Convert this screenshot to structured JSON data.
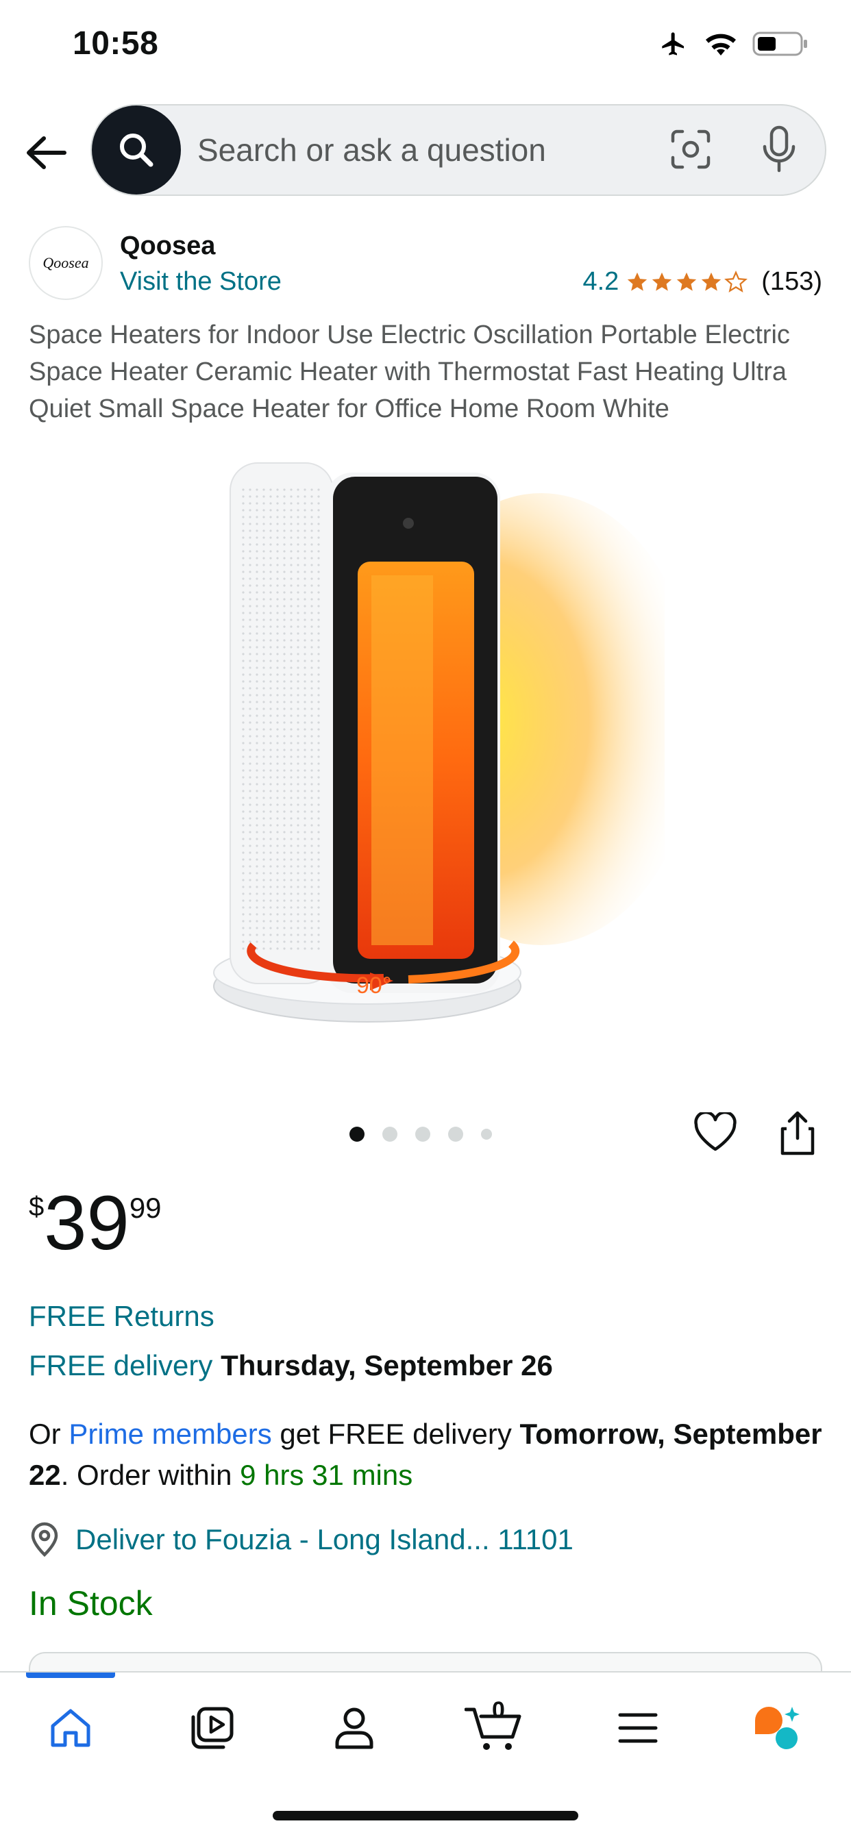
{
  "status_bar": {
    "time": "10:58",
    "icons": [
      "airplane-icon",
      "wifi-icon",
      "battery-icon"
    ]
  },
  "header": {
    "search_placeholder": "Search or ask a question",
    "icons": [
      "back-arrow-icon",
      "search-icon",
      "camera-icon",
      "microphone-icon"
    ]
  },
  "brand": {
    "logo_text": "Qoosea",
    "name": "Qoosea",
    "visit_store": "Visit the Store"
  },
  "rating": {
    "value": "4.2",
    "stars_out_of_5": 4.2,
    "count": "(153)"
  },
  "product": {
    "title": "Space Heaters for Indoor Use Electric Oscillation Portable Electric Space Heater Ceramic Heater with Thermostat Fast Heating Ultra Quiet Small Space Heater for Office Home Room White",
    "image_label": "90°",
    "carousel": {
      "total": 5,
      "active_index": 0
    }
  },
  "price": {
    "currency": "$",
    "whole": "39",
    "fraction": "99"
  },
  "delivery": {
    "free_returns": "FREE Returns",
    "free_delivery_link": "FREE delivery",
    "free_delivery_date": "Thursday, September 26",
    "prime_prefix": "Or ",
    "prime_link": "Prime members",
    "prime_middle": " get FREE delivery ",
    "prime_date": "Tomorrow, September 22",
    "order_within_prefix": ". Order within ",
    "order_within_time": "9 hrs 31 mins",
    "deliver_to": "Deliver to Fouzia - Long Island... 11101",
    "stock": "In Stock"
  },
  "bottom_nav": {
    "items": [
      "home-icon",
      "video-icon",
      "account-icon",
      "cart-icon",
      "menu-icon",
      "rufus-icon"
    ],
    "cart_count": "0",
    "active": "home"
  },
  "colors": {
    "link": "#007185",
    "prime_blue": "#1d6ce4",
    "green": "#007600",
    "star": "#de7921",
    "search_button": "#131921"
  }
}
